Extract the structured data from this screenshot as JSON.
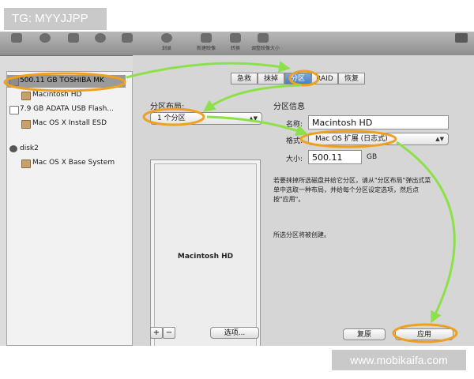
{
  "watermark": {
    "top": "TG: MYYJJPP",
    "bottom": "www.mobikaifa.com"
  },
  "toolbar": {
    "items": [
      {
        "icon": "burn-icon",
        "label": "刻录"
      },
      {
        "icon": "verify-icon",
        "label": "检查"
      },
      {
        "icon": "new-image-icon",
        "label": "新建映像"
      },
      {
        "icon": "convert-icon",
        "label": "转换"
      },
      {
        "icon": "resize-icon",
        "label": "调整映像大小"
      }
    ]
  },
  "sidebar": {
    "items": [
      {
        "label": "500.11 GB TOSHIBA MK",
        "kind": "disk",
        "selected": true
      },
      {
        "label": "Macintosh HD",
        "kind": "volume"
      },
      {
        "label": "7.9 GB ADATA USB Flash...",
        "kind": "usb"
      },
      {
        "label": "Mac OS X Install ESD",
        "kind": "volume"
      },
      {
        "label": "disk2",
        "kind": "disc"
      },
      {
        "label": "Mac OS X Base System",
        "kind": "volume"
      }
    ]
  },
  "tabs": [
    {
      "label": "急救"
    },
    {
      "label": "抹掉"
    },
    {
      "label": "分区",
      "active": true
    },
    {
      "label": "RAID"
    },
    {
      "label": "恢复"
    }
  ],
  "partition": {
    "layout_label": "分区布局:",
    "layout_value": "1 个分区",
    "info_label": "分区信息",
    "name_label": "名称:",
    "name_value": "Macintosh HD",
    "format_label": "格式:",
    "format_value": "Mac OS 扩展 (日志式)",
    "size_label": "大小:",
    "size_value": "500.11",
    "size_unit": "GB",
    "box_name": "Macintosh HD",
    "desc_lines": [
      "若要抹掉所选磁盘并给它分区，请从\"分区布局\"弹出式菜",
      "单中选取一种布局，并给每个分区设定选项，然后点",
      "按\"应用\"。"
    ],
    "status": "所选分区将被创建。",
    "plus_label": "+",
    "minus_label": "−",
    "options_label": "选项...",
    "revert_label": "复原",
    "apply_label": "应用"
  },
  "colors": {
    "annotation_green": "#8ee04a",
    "annotation_orange": "#f0a020",
    "selected_tab": "#4a7fc2"
  }
}
